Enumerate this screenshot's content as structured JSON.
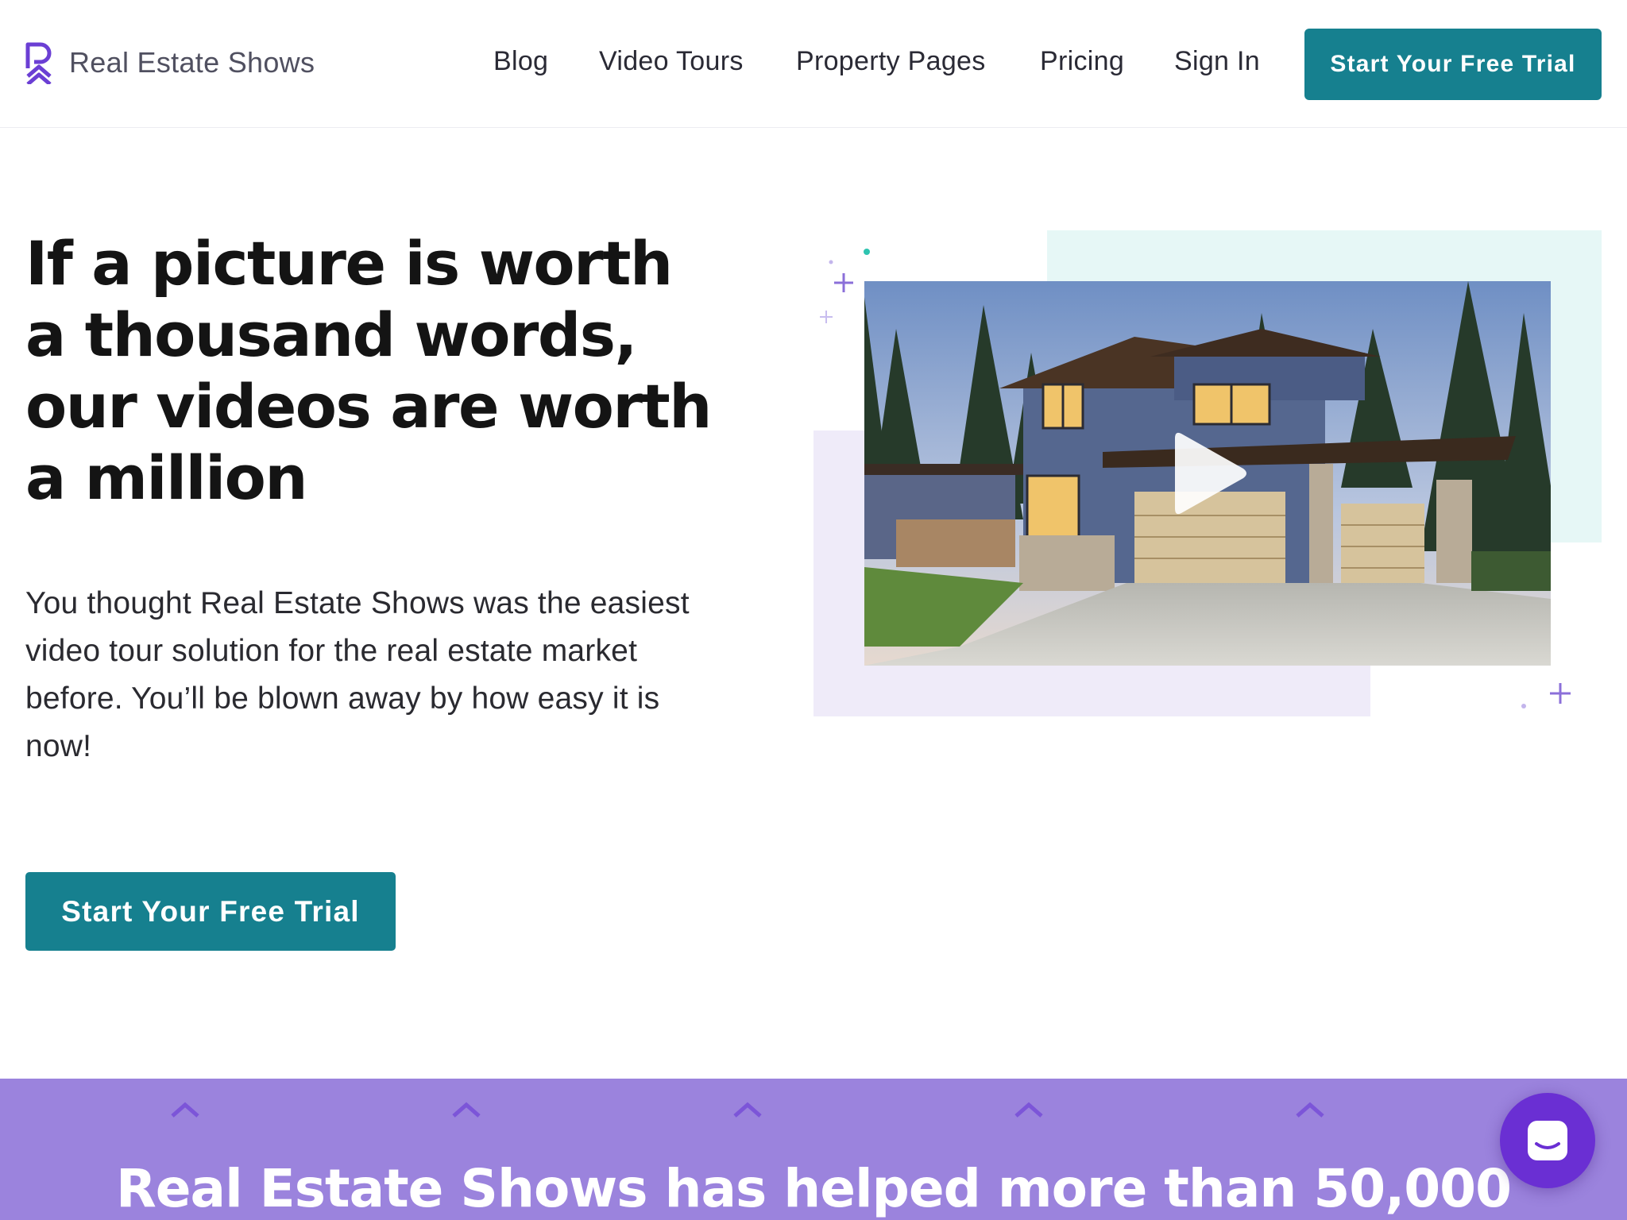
{
  "header": {
    "logo_text": "Real Estate Shows",
    "nav": [
      {
        "label": "Blog"
      },
      {
        "label": "Video Tours"
      },
      {
        "label": "Property Pages"
      },
      {
        "label": "Pricing"
      },
      {
        "label": "Sign In"
      }
    ],
    "cta_label": "Start Your Free Trial"
  },
  "hero": {
    "title": "If a picture is worth a thousand words, our videos are worth a million",
    "body": "You thought Real Estate Shows was the easiest video tour solution for the real estate market before. You’ll be blown away by how easy it is now!",
    "cta_label": "Start Your Free Trial",
    "video": {
      "icon": "play-icon"
    }
  },
  "band": {
    "title": "Real Estate Shows has helped more than 50,000"
  },
  "chat": {
    "icon": "chat-bubble-icon"
  },
  "colors": {
    "brand_teal": "#16808f",
    "brand_purple": "#6a2fd3",
    "band_purple": "#9b83dd",
    "mint_bg": "#e6f7f6",
    "lavender_bg": "#efebf9"
  }
}
